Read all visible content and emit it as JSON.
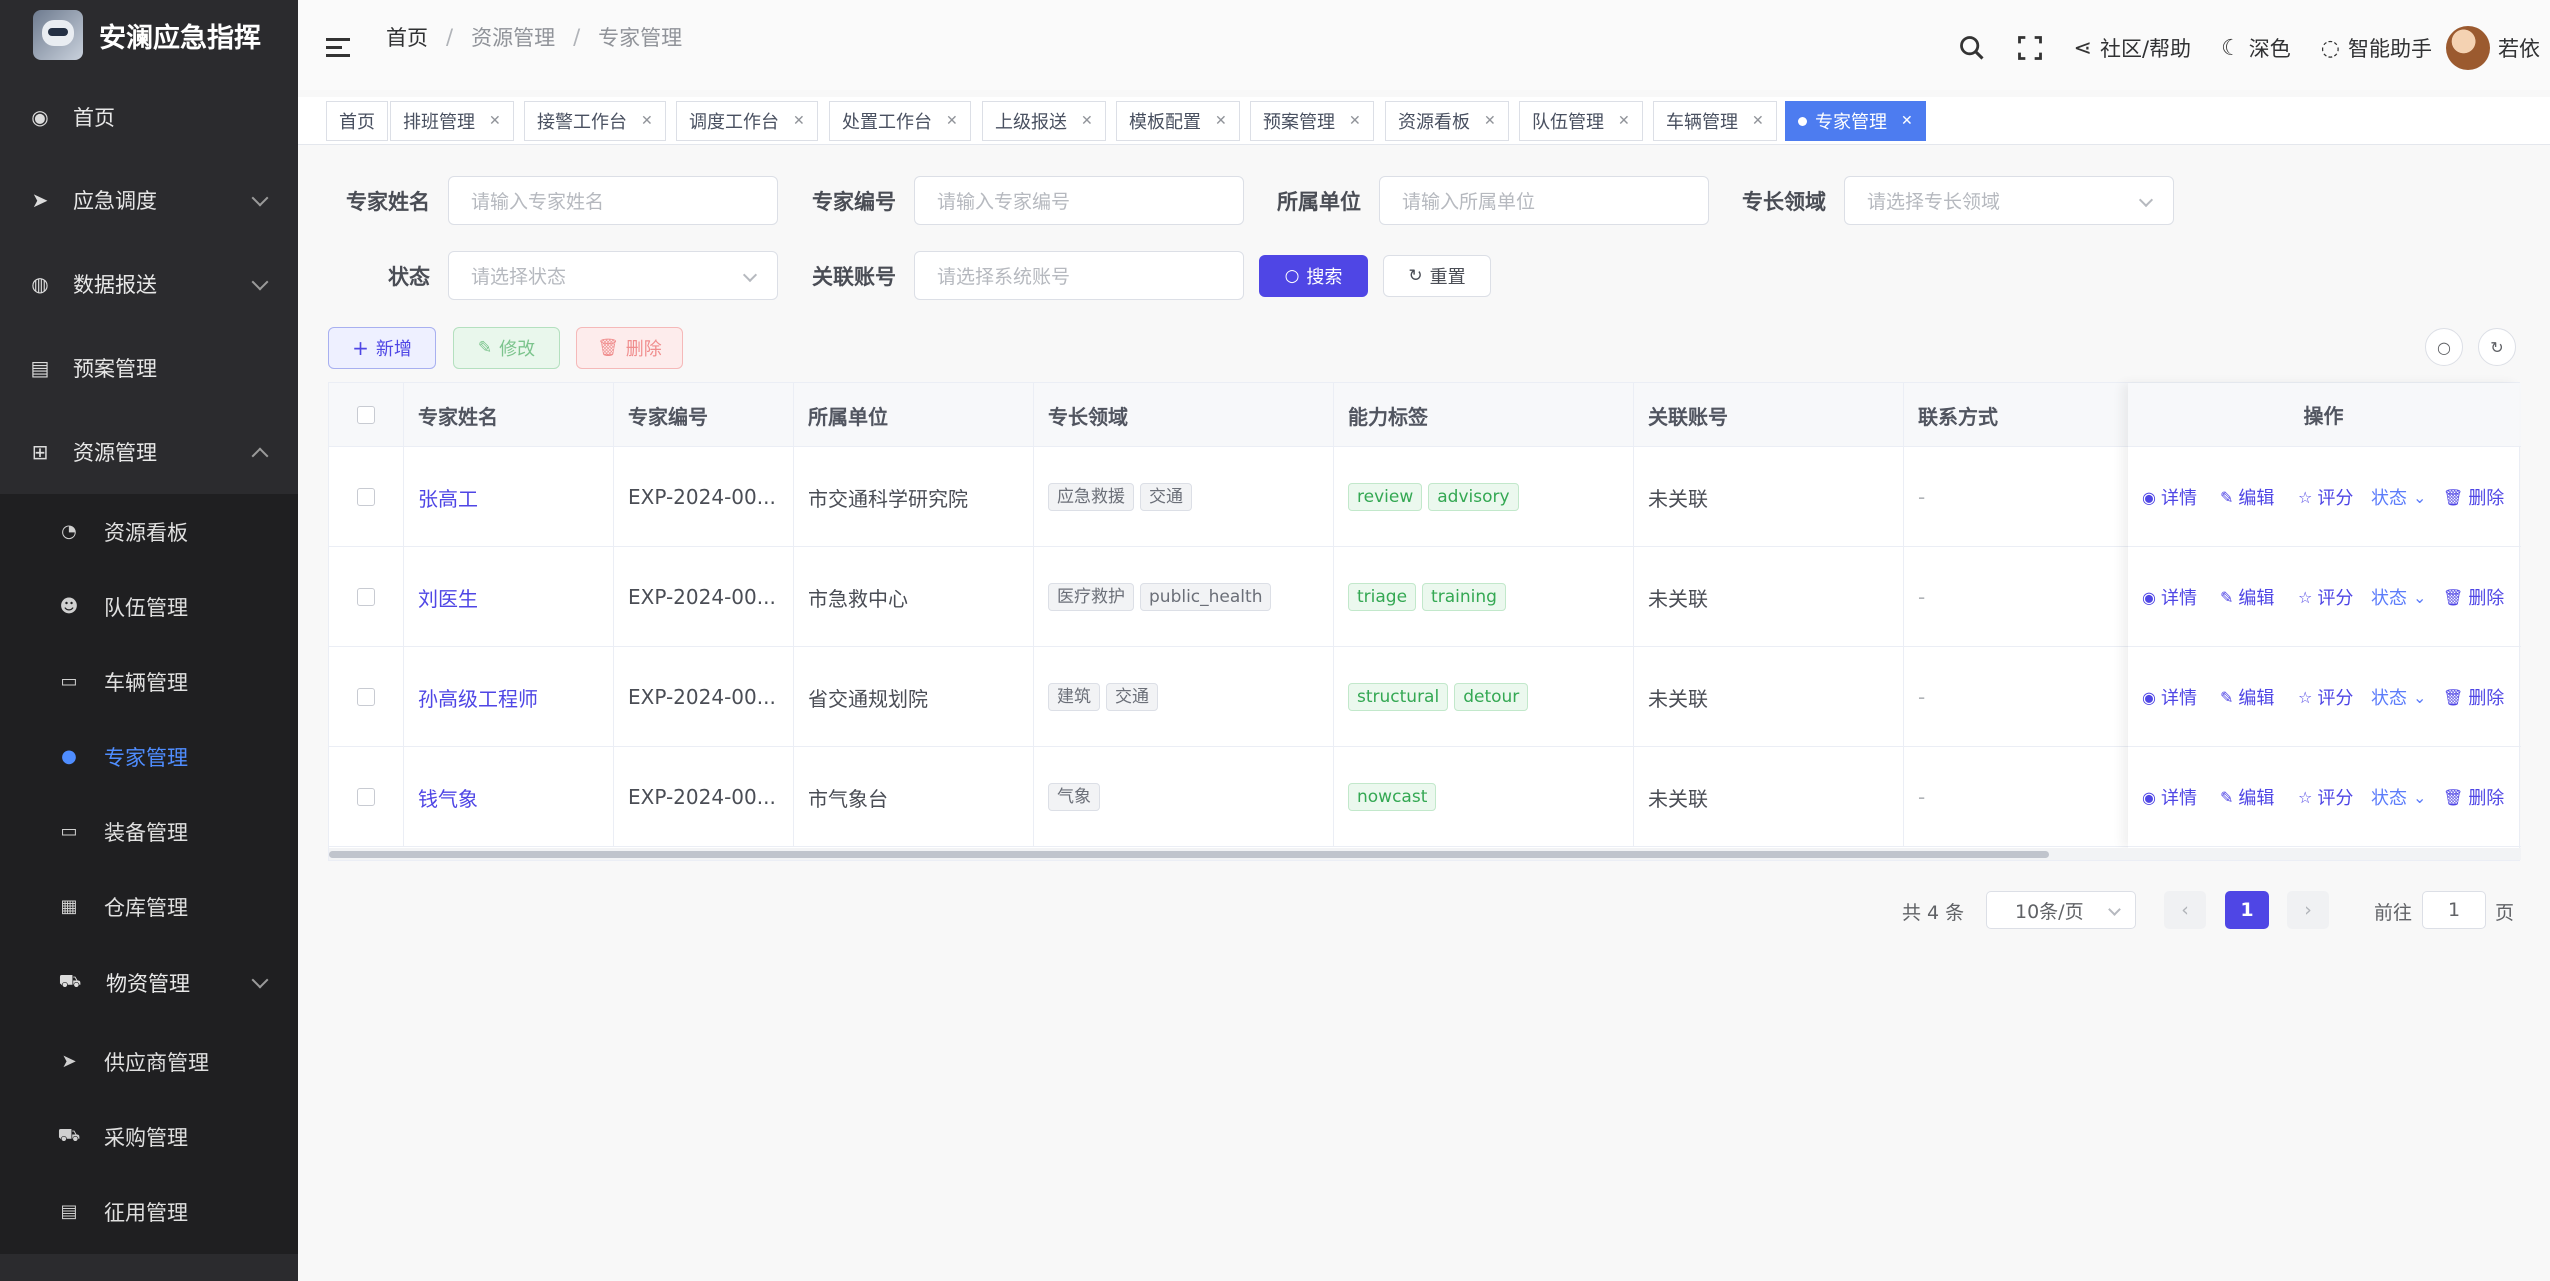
{
  "app": {
    "title": "安澜应急指挥"
  },
  "sidebar": {
    "items": [
      {
        "label": "首页",
        "icon": "dashboard-icon"
      },
      {
        "label": "应急调度",
        "icon": "send-icon"
      },
      {
        "label": "数据报送",
        "icon": "globe-icon"
      },
      {
        "label": "预案管理",
        "icon": "document-icon"
      },
      {
        "label": "资源管理",
        "icon": "hierarchy-icon"
      }
    ],
    "sub_items": [
      {
        "label": "资源看板",
        "icon": "gauge-icon"
      },
      {
        "label": "队伍管理",
        "icon": "team-icon"
      },
      {
        "label": "车辆管理",
        "icon": "briefcase-icon"
      },
      {
        "label": "专家管理",
        "icon": "user-icon",
        "active": true
      },
      {
        "label": "装备管理",
        "icon": "briefcase-icon"
      },
      {
        "label": "仓库管理",
        "icon": "grid-icon"
      },
      {
        "label": "物资管理",
        "icon": "cart-icon"
      },
      {
        "label": "供应商管理",
        "icon": "send-icon"
      },
      {
        "label": "采购管理",
        "icon": "cart-icon"
      },
      {
        "label": "征用管理",
        "icon": "document-icon"
      }
    ]
  },
  "header": {
    "breadcrumb": [
      "首页",
      "资源管理",
      "专家管理"
    ],
    "community": "社区/帮助",
    "theme": "深色",
    "assistant": "智能助手",
    "username": "若依"
  },
  "tabs": [
    "首页",
    "排班管理",
    "接警工作台",
    "调度工作台",
    "处置工作台",
    "上级报送",
    "模板配置",
    "预案管理",
    "资源看板",
    "队伍管理",
    "车辆管理",
    "专家管理"
  ],
  "search": {
    "name_label": "专家姓名",
    "name_placeholder": "请输入专家姓名",
    "code_label": "专家编号",
    "code_placeholder": "请输入专家编号",
    "org_label": "所属单位",
    "org_placeholder": "请输入所属单位",
    "field_label": "专长领域",
    "field_placeholder": "请选择专长领域",
    "status_label": "状态",
    "status_placeholder": "请选择状态",
    "account_label": "关联账号",
    "account_placeholder": "请选择系统账号",
    "search_button": "搜索",
    "reset_button": "重置"
  },
  "toolbar": {
    "add": "新增",
    "edit": "修改",
    "delete": "删除"
  },
  "table": {
    "columns": [
      "专家姓名",
      "专家编号",
      "所属单位",
      "专长领域",
      "能力标签",
      "关联账号",
      "联系方式",
      "操作"
    ],
    "rows": [
      {
        "name": "张高工",
        "code": "EXP-2024-00...",
        "org": "市交通科学研究院",
        "fields": [
          "应急救援",
          "交通"
        ],
        "tags": [
          "review",
          "advisory"
        ],
        "account": "未关联",
        "contact": "-"
      },
      {
        "name": "刘医生",
        "code": "EXP-2024-00...",
        "org": "市急救中心",
        "fields": [
          "医疗救护",
          "public_health"
        ],
        "tags": [
          "triage",
          "training"
        ],
        "account": "未关联",
        "contact": "-"
      },
      {
        "name": "孙高级工程师",
        "code": "EXP-2024-00...",
        "org": "省交通规划院",
        "fields": [
          "建筑",
          "交通"
        ],
        "tags": [
          "structural",
          "detour"
        ],
        "account": "未关联",
        "contact": "-"
      },
      {
        "name": "钱气象",
        "code": "EXP-2024-00...",
        "org": "市气象台",
        "fields": [
          "气象"
        ],
        "tags": [
          "nowcast"
        ],
        "account": "未关联",
        "contact": "-"
      }
    ],
    "ops": {
      "detail": "详情",
      "edit": "编辑",
      "rate": "评分",
      "status": "状态",
      "delete": "删除"
    }
  },
  "pagination": {
    "total": "共 4 条",
    "page_size": "10条/页",
    "current": "1",
    "goto_prefix": "前往",
    "goto_value": "1",
    "goto_suffix": "页"
  },
  "colors": {
    "primary": "#4f46e5",
    "active_tab": "#4d7cf0",
    "sidebar_bg": "#2b2b2e",
    "sidebar_active": "#4f8dff"
  }
}
